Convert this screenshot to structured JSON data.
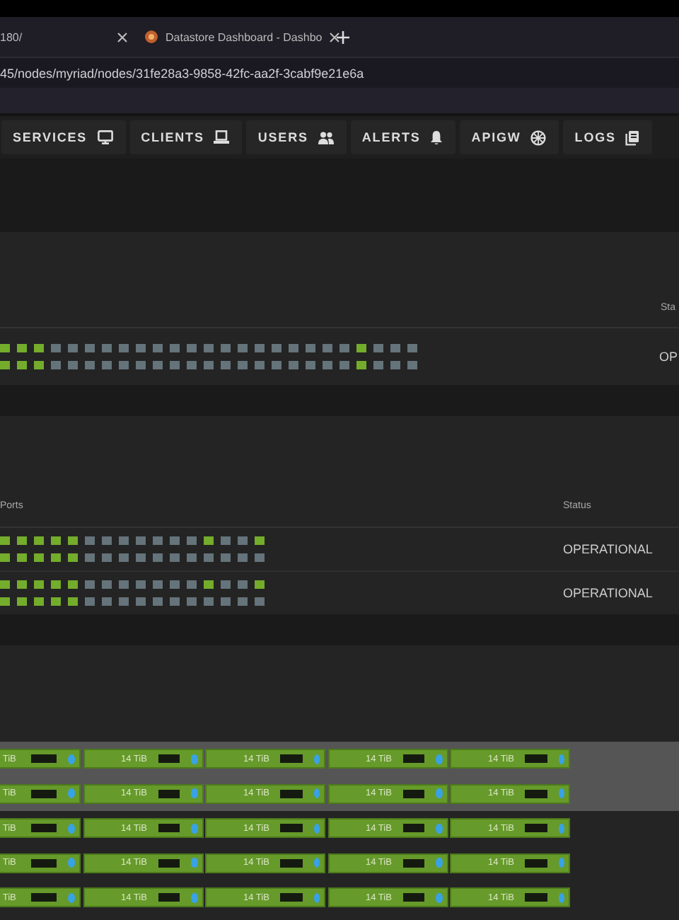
{
  "browser": {
    "tabs": [
      {
        "title": "180/",
        "selected": false
      },
      {
        "title": "Datastore Dashboard - Dashbo",
        "selected": true
      }
    ],
    "address": "45/nodes/myriad/nodes/31fe28a3-9858-42fc-aa2f-3cabf9e21e6a"
  },
  "nav": [
    {
      "label": "SERVICES",
      "kind": "monitor"
    },
    {
      "label": "CLIENTS",
      "kind": "laptop"
    },
    {
      "label": "USERS",
      "kind": "users"
    },
    {
      "label": "ALERTS",
      "kind": "bell"
    },
    {
      "label": "APIGW",
      "kind": "globe"
    },
    {
      "label": "LOGS",
      "kind": "logs"
    }
  ],
  "network_panel": {
    "status_header": "Sta",
    "rows": [
      {
        "status": "OP",
        "ports": [
          [
            true,
            true,
            true,
            false,
            false,
            false,
            false,
            false,
            false,
            false,
            false,
            false,
            false,
            false,
            false,
            false,
            false,
            false,
            false,
            false,
            false,
            true,
            false,
            false,
            false
          ],
          [
            true,
            true,
            true,
            false,
            false,
            false,
            false,
            false,
            false,
            false,
            false,
            false,
            false,
            false,
            false,
            false,
            false,
            false,
            false,
            false,
            false,
            true,
            false,
            false,
            false
          ]
        ]
      }
    ]
  },
  "switch_panel": {
    "ports_header": "Ports",
    "status_header": "Status",
    "rows": [
      {
        "status": "OPERATIONAL",
        "ports": [
          [
            true,
            true,
            true,
            true,
            true,
            false,
            false,
            false,
            false,
            false,
            false,
            false,
            true,
            false,
            false,
            true
          ],
          [
            true,
            true,
            true,
            true,
            true,
            false,
            false,
            false,
            false,
            false,
            false,
            false,
            false,
            false,
            false,
            false
          ]
        ]
      },
      {
        "status": "OPERATIONAL",
        "ports": [
          [
            true,
            true,
            true,
            true,
            true,
            false,
            false,
            false,
            false,
            false,
            false,
            false,
            true,
            false,
            false,
            true
          ],
          [
            true,
            true,
            true,
            true,
            true,
            false,
            false,
            false,
            false,
            false,
            false,
            false,
            false,
            false,
            false,
            false
          ]
        ]
      }
    ]
  },
  "disk_rows": [
    {
      "selected": true,
      "disks": [
        "TiB",
        "14 TiB",
        "14 TiB",
        "14 TiB",
        "14 TiB"
      ]
    },
    {
      "selected": true,
      "disks": [
        "TiB",
        "14 TiB",
        "14 TiB",
        "14 TiB",
        "14 TiB"
      ]
    },
    {
      "selected": false,
      "disks": [
        "TiB",
        "14 TiB",
        "14 TiB",
        "14 TiB",
        "14 TiB"
      ]
    },
    {
      "selected": false,
      "disks": [
        "TiB",
        "14 TiB",
        "14 TiB",
        "14 TiB",
        "14 TiB"
      ]
    },
    {
      "selected": false,
      "disks": [
        "TiB",
        "14 TiB",
        "14 TiB",
        "14 TiB",
        "14 TiB"
      ]
    }
  ]
}
